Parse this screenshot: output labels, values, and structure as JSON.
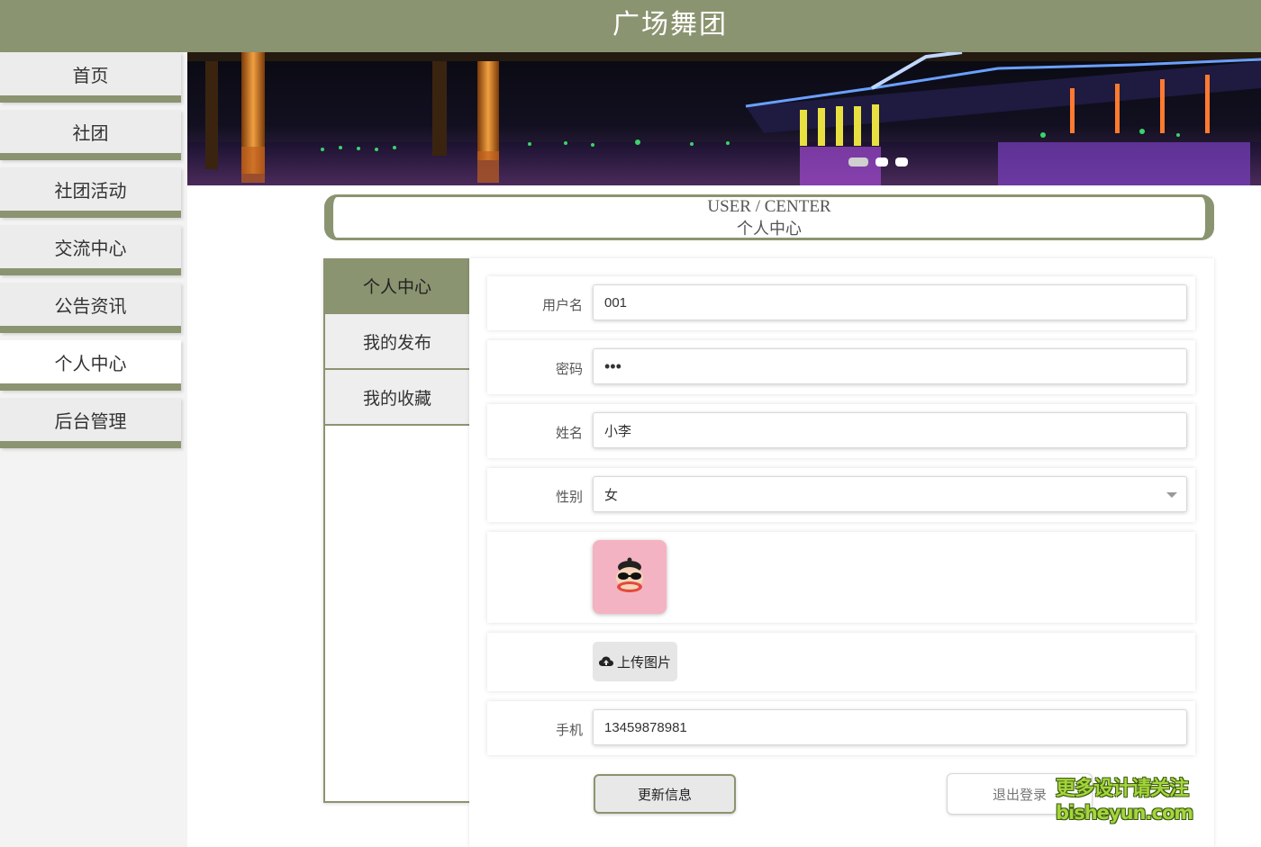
{
  "app": {
    "title": "广场舞团"
  },
  "sidebar": {
    "items": [
      {
        "label": "首页"
      },
      {
        "label": "社团"
      },
      {
        "label": "社团活动"
      },
      {
        "label": "交流中心"
      },
      {
        "label": "公告资讯"
      },
      {
        "label": "个人中心",
        "active": true
      },
      {
        "label": "后台管理"
      }
    ]
  },
  "banner": {
    "slides": 3,
    "active_slide": 1
  },
  "section": {
    "title_en": "USER / CENTER",
    "title_cn": "个人中心"
  },
  "submenu": {
    "items": [
      {
        "label": "个人中心",
        "active": true
      },
      {
        "label": "我的发布"
      },
      {
        "label": "我的收藏"
      }
    ]
  },
  "form": {
    "username": {
      "label": "用户名",
      "value": "001"
    },
    "password": {
      "label": "密码",
      "value": "•••"
    },
    "name": {
      "label": "姓名",
      "value": "小李"
    },
    "gender": {
      "label": "性别",
      "value": "女"
    },
    "avatar": {
      "icon": "monkey-avatar"
    },
    "upload": {
      "label": "上传图片",
      "icon": "cloud-upload-icon"
    },
    "phone": {
      "label": "手机",
      "value": "13459878981"
    }
  },
  "actions": {
    "update": "更新信息",
    "logout": "退出登录"
  },
  "watermark": {
    "line1": "更多设计请关注",
    "line2": "bisheyun.com"
  },
  "colors": {
    "accent": "#8b9470",
    "sidebar_bg": "#f3f3f3"
  }
}
